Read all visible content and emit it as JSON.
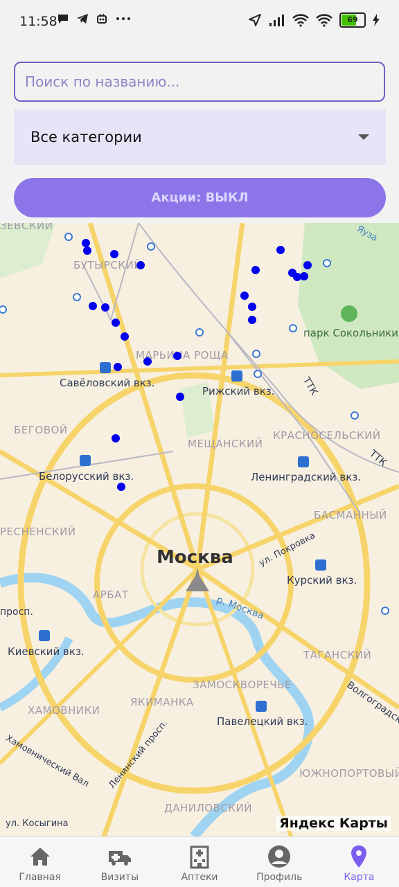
{
  "status_bar": {
    "time": "11:58",
    "battery": "69",
    "icons": [
      "chat-bubble-icon",
      "telegram-icon",
      "robot-icon",
      "more-dots-icon",
      "location-arrow-icon",
      "cell-signal-icon",
      "wifi-icon",
      "wifi-icon",
      "battery-icon",
      "charging-icon"
    ]
  },
  "search": {
    "placeholder": "Поиск по названию..."
  },
  "category_select": {
    "selected": "Все категории"
  },
  "promo_toggle": {
    "label": "Акции: ВЫКЛ"
  },
  "map": {
    "city": "Москва",
    "district_labels": [
      "ЗЕВСКИЙ",
      "БУТЫРСКИЙ",
      "МАРЬИНА РОЩА",
      "БЕГОВОЙ",
      "МЕЩАНСКИЙ",
      "КРАСНОСЕЛЬСКИЙ",
      "БАСМАННЫЙ",
      "РЕСНЕНСКИЙ",
      "АРБАТ",
      "ТАГАНСКИЙ",
      "ЗАМОСКВОРЕЧЬЕ",
      "ХАМОВНИКИ",
      "ЯКИМАНКА",
      "ЮЖНОПОРТОВЫЙ",
      "ДАНИЛОВСКИЙ"
    ],
    "stations": [
      "Савёловский вкз.",
      "Рижский вкз.",
      "Белорусский вкз.",
      "Ленинградский вкз.",
      "Курский вкз.",
      "Киевский вкз.",
      "Павелецкий вкз."
    ],
    "streets": [
      "ул. Покровка",
      "р. Москва",
      "Волгоградский",
      "Хамовнический Вал",
      "Ленинский просп.",
      "ул. Косыгина",
      "просп.",
      "Яуза",
      "ТТК",
      "ТТК"
    ],
    "park": "парк Сокольники",
    "attribution": "Яндекс Карты",
    "marker_color": "#0000ee"
  },
  "bottom_nav": [
    {
      "label": "Главная",
      "icon": "home-icon"
    },
    {
      "label": "Визиты",
      "icon": "ambulance-icon"
    },
    {
      "label": "Аптеки",
      "icon": "hospital-icon"
    },
    {
      "label": "Профиль",
      "icon": "profile-icon"
    },
    {
      "label": "Карта",
      "icon": "map-pin-icon",
      "active": true
    }
  ],
  "colors": {
    "accent": "#7b5ef0",
    "button": "#8b75e9",
    "select_bg": "#e6e4f7"
  }
}
